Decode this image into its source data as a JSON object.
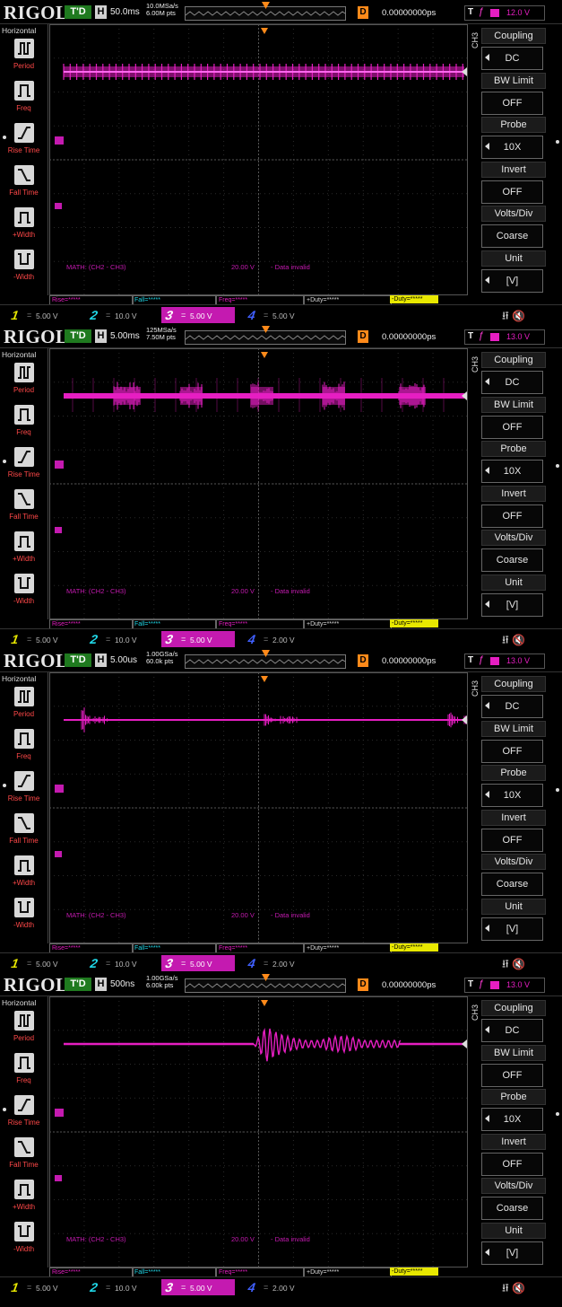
{
  "brand": "RIGOL",
  "colors": {
    "ch3": "#e61ec2",
    "ch1": "#e8e800",
    "ch2": "#20d8e8",
    "ch4": "#4060ff",
    "trig_status": "#1f7a1f",
    "delay_badge": "#ff8a1a",
    "menu_label": "#ff4848"
  },
  "left_menu": {
    "title": "Horizontal",
    "items": [
      {
        "label": "Period",
        "icon": "period-pulse-icon"
      },
      {
        "label": "Freq",
        "icon": "frequency-pulse-icon"
      },
      {
        "label": "Rise Time",
        "icon": "rise-edge-icon"
      },
      {
        "label": "Fall Time",
        "icon": "fall-edge-icon"
      },
      {
        "label": "+Width",
        "icon": "positive-width-icon"
      },
      {
        "label": "-Width",
        "icon": "negative-width-icon"
      }
    ]
  },
  "soft_menu": {
    "channel": "CH3",
    "items": [
      {
        "header": "Coupling",
        "value": "DC",
        "arrow": true
      },
      {
        "header": "BW Limit",
        "value": "OFF",
        "arrow": false
      },
      {
        "header": "Probe",
        "value": "10X",
        "arrow": true
      },
      {
        "header": "Invert",
        "value": "OFF",
        "arrow": false
      },
      {
        "header": "Volts/Div",
        "value": "Coarse",
        "arrow": false
      },
      {
        "header": "Unit",
        "value": "[V]",
        "arrow": true
      }
    ]
  },
  "measurements": {
    "rise": "Rise=*****",
    "fall": "Fall=*****",
    "freq": "Freq=*****",
    "duty_pos": "+Duty=*****",
    "duty_neg": "-Duty=*****"
  },
  "math": {
    "label": "MATH: (CH2 - CH3)",
    "scale": "20.00 V",
    "status": "- Data invalid"
  },
  "delay": "0.00000000ps",
  "trigger_source_label": "T",
  "trigger_status": "T'D",
  "screens": [
    {
      "timebase": "50.0ms",
      "sample_rate": "10.0MSa/s",
      "mem_depth": "6.00M pts",
      "trigger_level": "12.0 V",
      "channels": {
        "ch1": "5.00 V",
        "ch2": "10.0 V",
        "ch3": "5.00 V",
        "ch4": "5.00 V"
      },
      "waveform": "dense"
    },
    {
      "timebase": "5.00ms",
      "sample_rate": "125MSa/s",
      "mem_depth": "7.50M pts",
      "trigger_level": "13.0 V",
      "channels": {
        "ch1": "5.00 V",
        "ch2": "10.0 V",
        "ch3": "5.00 V",
        "ch4": "2.00 V"
      },
      "waveform": "bursts"
    },
    {
      "timebase": "5.00us",
      "sample_rate": "1.00GSa/s",
      "mem_depth": "60.0k pts",
      "trigger_level": "13.0 V",
      "channels": {
        "ch1": "5.00 V",
        "ch2": "10.0 V",
        "ch3": "5.00 V",
        "ch4": "2.00 V"
      },
      "waveform": "spikes"
    },
    {
      "timebase": "500ns",
      "sample_rate": "1.00GSa/s",
      "mem_depth": "6.00k pts",
      "trigger_level": "13.0 V",
      "channels": {
        "ch1": "5.00 V",
        "ch2": "10.0 V",
        "ch3": "5.00 V",
        "ch4": "2.00 V"
      },
      "waveform": "ringing"
    }
  ]
}
